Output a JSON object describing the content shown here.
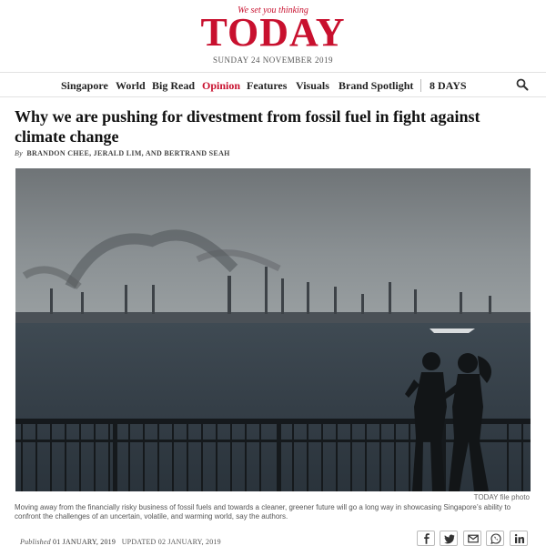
{
  "masthead": {
    "tagline": "We set you thinking",
    "logo": "TODAY",
    "date": "SUNDAY 24 NOVEMBER 2019",
    "brand_color": "#c8102e"
  },
  "nav": {
    "items": [
      {
        "label": "Singapore",
        "active": false
      },
      {
        "label": "World",
        "active": false
      },
      {
        "label": "Big Read",
        "active": false
      },
      {
        "label": "Opinion",
        "active": true
      },
      {
        "label": "Features",
        "active": false
      },
      {
        "label": "Visuals",
        "active": false
      },
      {
        "label": "Brand Spotlight",
        "active": false
      },
      {
        "label": "8 DAYS",
        "active": false
      }
    ],
    "search_icon": "search-icon"
  },
  "article": {
    "headline": "Why we are pushing for divestment from fossil fuel in fight against climate change",
    "byline_prefix": "By",
    "authors": "BRANDON CHEE, JERALD LIM, AND BERTRAND SEAH",
    "photo_credit": "TODAY file photo",
    "caption": "Moving away from the financially risky business of fossil fuels and towards a cleaner, greener future will go a long way in showcasing Singapore’s ability to confront the challenges of an uncertain, volatile, and warming world, say the authors.",
    "published_label": "Published",
    "published_date": "01 JANUARY, 2019",
    "updated_label": "UPDATED",
    "updated_date": "02 JANUARY, 2019"
  },
  "share": {
    "buttons": [
      "facebook-icon",
      "twitter-icon",
      "email-icon",
      "whatsapp-icon",
      "linkedin-icon"
    ]
  }
}
